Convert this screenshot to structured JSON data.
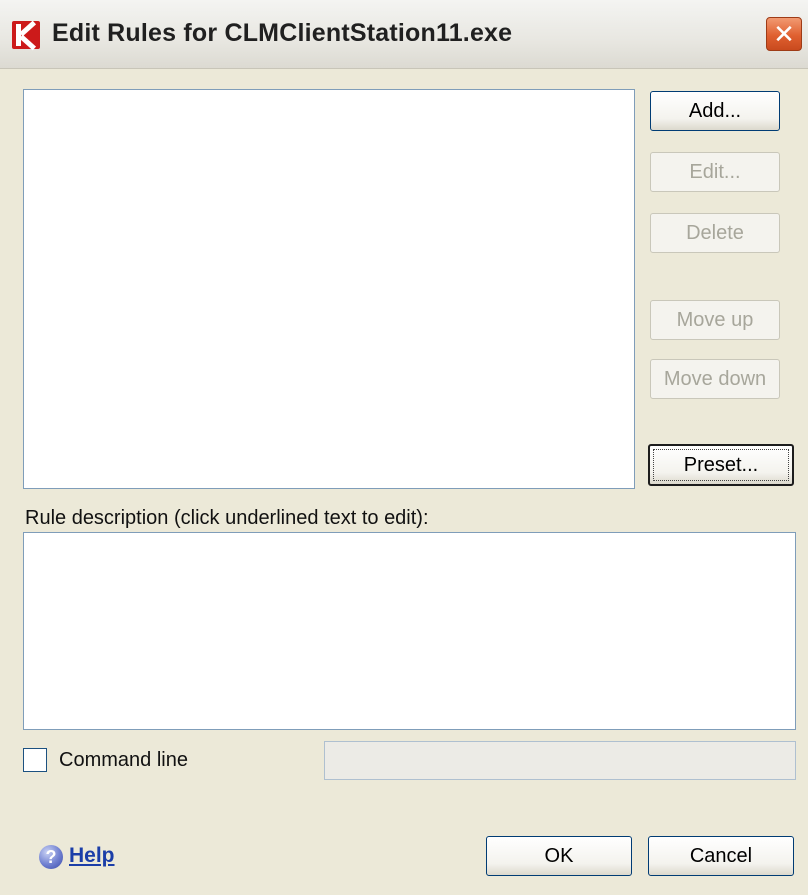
{
  "window": {
    "title": "Edit Rules for CLMClientStation11.exe",
    "close_glyph": "✕",
    "app_icon": "kaspersky-k-icon"
  },
  "side_buttons": {
    "add": "Add...",
    "edit": "Edit...",
    "delete": "Delete",
    "move_up": "Move up",
    "move_down": "Move down",
    "preset": "Preset..."
  },
  "rule_description_label": "Rule description (click underlined text to edit):",
  "command_line": {
    "label": "Command line",
    "checked": false,
    "value": ""
  },
  "footer": {
    "help_icon": "help-question-icon",
    "help_glyph": "?",
    "help_label": "Help",
    "ok_label": "OK",
    "cancel_label": "Cancel"
  },
  "colors": {
    "dialog_background": "#ece9d8",
    "close_button": "#e06030",
    "help_link": "#1b3ea8"
  }
}
